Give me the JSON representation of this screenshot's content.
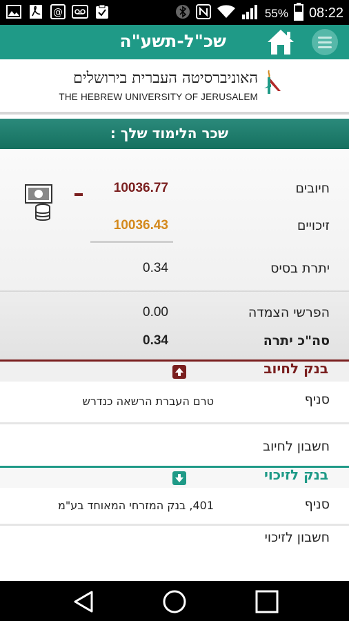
{
  "status_bar": {
    "battery": "55%",
    "time": "08:22"
  },
  "app_bar": {
    "title": "שכ\"ל-תשע\"ה"
  },
  "logo": {
    "hebrew": "האוניברסיטה העברית בירושלים",
    "english": "THE HEBREW UNIVERSITY OF JERUSALEM"
  },
  "section": {
    "title": "שכר הלימוד שלך :"
  },
  "summary": {
    "debits_label": "חיובים",
    "debits_value": "10036.77",
    "credits_label": "זיכויים",
    "credits_value": "10036.43",
    "base_balance_label": "יתרת בסיס",
    "base_balance_value": "0.34",
    "linkage_label": "הפרשי הצמדה",
    "linkage_value": "0.00",
    "total_label": "סה\"כ יתרה",
    "total_value": "0.34"
  },
  "bank_debit": {
    "title": "בנק לחיוב",
    "branch_label": "סניף",
    "branch_value": "טרם העברת הרשאה כנדרש",
    "account_label": "חשבון לחיוב"
  },
  "bank_credit": {
    "title": "בנק לזיכוי",
    "branch_label": "סניף",
    "branch_value": "401, בנק המזרחי המאוחד בע\"מ",
    "account_label": "חשבון לזיכוי"
  },
  "colors": {
    "accent": "#1f9a87",
    "debit": "#7a1f1f",
    "credit": "#d4891c"
  },
  "icons": [
    "picture-icon",
    "pdf-icon",
    "at-icon",
    "voicemail-icon",
    "clipboard-check-icon",
    "bluetooth-icon",
    "nfc-icon",
    "wifi-icon",
    "signal-icon",
    "battery-icon",
    "home-icon",
    "menu-icon",
    "money-stack-icon",
    "arrow-up-icon",
    "arrow-down-icon",
    "back-icon",
    "home-circle-icon",
    "recents-icon"
  ]
}
